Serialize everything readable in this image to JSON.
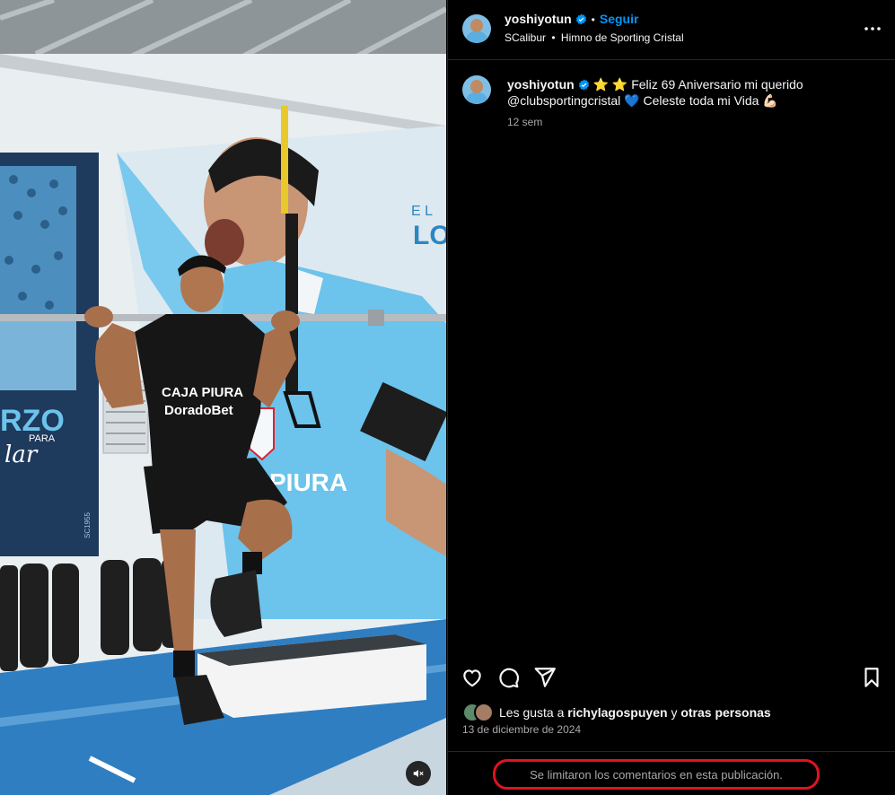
{
  "header": {
    "username": "yoshiyotun",
    "separator": "•",
    "follow_label": "Seguir",
    "audio": "SCalibur",
    "audio_separator": "•",
    "audio_track": "Himno de Sporting Cristal"
  },
  "caption": {
    "username": "yoshiyotun",
    "emojis": "⭐ ⭐",
    "text_line1": "Feliz 69 Aniversario mi querido",
    "mention": "@clubsportingcristal",
    "heart": "💙",
    "text_line2": "Celeste toda mi Vida",
    "flex": "💪🏻",
    "time_ago": "12 sem"
  },
  "likes": {
    "prefix": "Les gusta a",
    "user": "richylagospuyen",
    "connector": "y",
    "others": "otras personas"
  },
  "date": "13 de diciembre de 2024",
  "comments_notice": "Se limitaron los comentarios en esta publicación.",
  "photo": {
    "shirt_sponsor_line1": "CAJA PIURA",
    "shirt_sponsor_line2": "DoradoBet",
    "mural_text_el": "E L",
    "mural_text_lo": "LO",
    "banner_text_rzo": "RZO",
    "banner_text_para": "PARA",
    "banner_text_lar": "lar",
    "banner_text_sc": "SC1955",
    "mural_piura": "PIURA"
  },
  "icons": [
    "verified-icon",
    "more-icon",
    "heart-icon",
    "comment-icon",
    "share-icon",
    "bookmark-icon",
    "mute-icon"
  ],
  "colors": {
    "accent": "#0095f6",
    "highlight": "#e0131f",
    "mural": "#6cc3ec"
  }
}
